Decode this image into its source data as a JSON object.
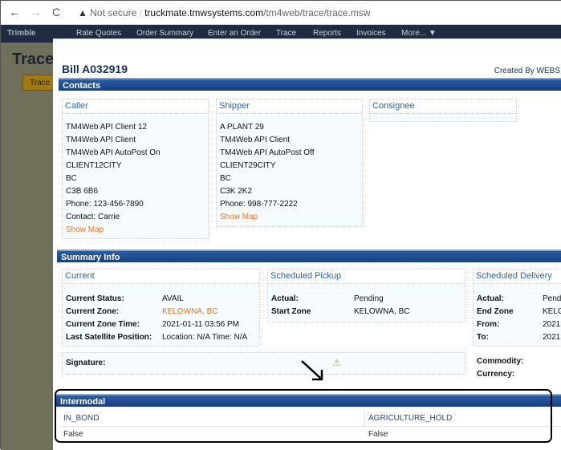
{
  "browser": {
    "back": "←",
    "forward": "→",
    "reload": "C",
    "security": "Not secure",
    "url_host": "truckmate.tmwsystems.com",
    "url_path": "/tm4web/trace/trace.msw"
  },
  "appnav": {
    "logo": "Trimble",
    "items": [
      "Rate Quotes",
      "Order Summary",
      "Enter an Order",
      "Trace",
      "Reports",
      "Invoices",
      "More... ▼"
    ]
  },
  "background": {
    "title": "Trace",
    "button": "Trace"
  },
  "bill": {
    "title": "Bill A032919",
    "created_by": "Created By WEBS"
  },
  "contacts": {
    "header": "Contacts",
    "caller": {
      "title": "Caller",
      "lines": [
        "TM4Web API Client 12",
        "TM4Web API Client",
        "TM4Web API AutoPost On",
        "CLIENT12CITY",
        "BC",
        "C3B 6B6",
        "Phone: 123-456-7890",
        "Contact: Carrie"
      ],
      "map": "Show Map"
    },
    "shipper": {
      "title": "Shipper",
      "lines": [
        "A PLANT 29",
        "TM4Web API Client",
        "TM4Web API AutoPost Off",
        "CLIENT29CITY",
        "BC",
        "C3K 2K2",
        "Phone: 998-777-2222"
      ],
      "map": "Show Map"
    },
    "consignee": {
      "title": "Consignee"
    }
  },
  "summary": {
    "header": "Summary Info",
    "current": {
      "title": "Current",
      "rows": [
        {
          "label": "Current Status:",
          "value": "AVAIL"
        },
        {
          "label": "Current Zone:",
          "value": "KELOWNA, BC"
        },
        {
          "label": "Current Zone Time:",
          "value": "2021-01-11 03:56 PM"
        },
        {
          "label": "Last Satellite Position:",
          "value": "Location: N/A Time: N/A"
        }
      ]
    },
    "pickup": {
      "title": "Scheduled Pickup",
      "rows": [
        {
          "label": "Actual:",
          "value": "Pending"
        },
        {
          "label": "Start Zone",
          "value": "KELOWNA, BC"
        }
      ]
    },
    "delivery": {
      "title": "Scheduled Delivery",
      "rows": [
        {
          "label": "Actual:",
          "value": "Pend"
        },
        {
          "label": "End Zone",
          "value": "KELO"
        },
        {
          "label": "From:",
          "value": "2021"
        },
        {
          "label": "To:",
          "value": "2021"
        }
      ]
    },
    "signature": "Signature:",
    "commodity": "Commodity:",
    "currency": "Currency:"
  },
  "intermodal": {
    "header": "Intermodal",
    "columns": [
      "IN_BOND",
      "AGRICULTURE_HOLD"
    ],
    "values": [
      "False",
      "False"
    ]
  },
  "colors": {
    "accent": "#173f7c",
    "link": "#e07a22"
  }
}
